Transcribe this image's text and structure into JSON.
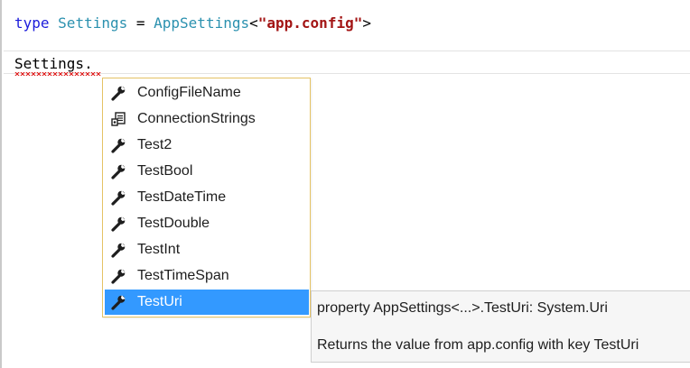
{
  "editor": {
    "line1": {
      "keyword": "type",
      "type_name": "Settings",
      "equals": " = ",
      "provider": "AppSettings",
      "open": "<",
      "argument": "\"app.config\"",
      "close": ">"
    },
    "line2": {
      "text": "Settings."
    }
  },
  "completion": {
    "items": [
      {
        "label": "ConfigFileName",
        "icon": "wrench-icon"
      },
      {
        "label": "ConnectionStrings",
        "icon": "collection-icon"
      },
      {
        "label": "Test2",
        "icon": "wrench-icon"
      },
      {
        "label": "TestBool",
        "icon": "wrench-icon"
      },
      {
        "label": "TestDateTime",
        "icon": "wrench-icon"
      },
      {
        "label": "TestDouble",
        "icon": "wrench-icon"
      },
      {
        "label": "TestInt",
        "icon": "wrench-icon"
      },
      {
        "label": "TestTimeSpan",
        "icon": "wrench-icon"
      },
      {
        "label": "TestUri",
        "icon": "wrench-icon"
      }
    ],
    "selected_label": "TestUri"
  },
  "tooltip": {
    "signature": "property AppSettings<...>.TestUri: System.Uri",
    "description": "Returns the value from app.config with key TestUri"
  },
  "colors": {
    "keyword": "#1c1cdb",
    "type": "#2b91af",
    "string": "#a31515",
    "selection": "#3399ff",
    "popup_border": "#e5c365",
    "error_squiggle": "#e02020"
  }
}
